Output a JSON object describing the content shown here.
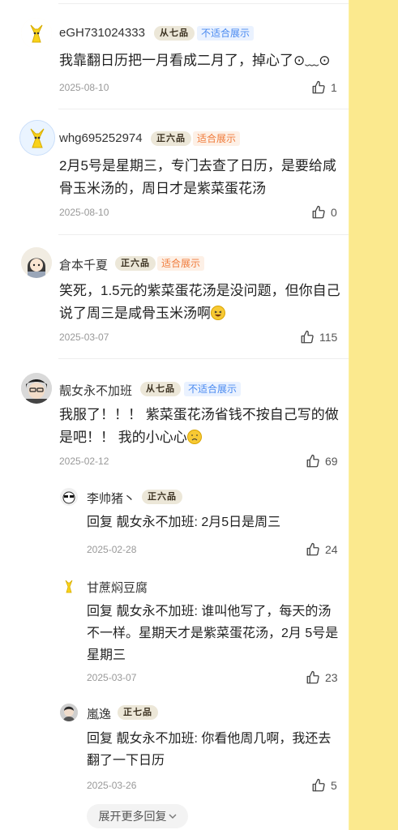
{
  "comments": [
    {
      "username": "eGH731024333",
      "badge": "从七品",
      "tag": "不适合展示",
      "text": "我靠翻日历把一月看成二月了，掉心了⊙﹏⊙",
      "date": "2025-08-10",
      "likes": "1"
    },
    {
      "username": "whg695252974",
      "badge": "正六品",
      "tag": "适合展示",
      "text": "2月5号是星期三，专门去查了日历，是要给咸骨玉米汤的，周日才是紫菜蛋花汤",
      "date": "2025-08-10",
      "likes": "0"
    },
    {
      "username": "倉本千夏",
      "badge": "正六品",
      "tag": "适合展示",
      "text": "笑死，1.5元的紫菜蛋花汤是没问题，但你自己说了周三是咸骨玉米汤啊",
      "date": "2025-03-07",
      "likes": "115"
    },
    {
      "username": "靓女永不加班",
      "badge": "从七品",
      "tag": "不适合展示",
      "text": "我服了！！！ 紫菜蛋花汤省钱不按自己写的做是吧！！ 我的小心心",
      "date": "2025-02-12",
      "likes": "69"
    }
  ],
  "replies": [
    {
      "username": "李帅猪丶",
      "badge": "正六品",
      "text": "回复  靓女永不加班: 2月5日是周三",
      "date": "2025-02-28",
      "likes": "24"
    },
    {
      "username": "甘蔗焖豆腐",
      "text": "回复  靓女永不加班: 谁叫他写了，每天的汤不一样。星期天才是紫菜蛋花汤，2月 5号是星期三",
      "date": "2025-03-07",
      "likes": "23"
    },
    {
      "username": "嵐逸",
      "badge": "正七品",
      "text": "回复  靓女永不加班: 你看他周几啊，我还去翻了一下日历",
      "date": "2025-03-26",
      "likes": "5"
    }
  ],
  "more_replies_label": "展开更多回复",
  "icons": {
    "like": "thumbs-up-icon",
    "expand": "chevron-down-icon"
  },
  "colors": {
    "page_bg": "#fdf0a0",
    "tag_blue": "#4a8af0",
    "tag_orange": "#f07a3a"
  }
}
